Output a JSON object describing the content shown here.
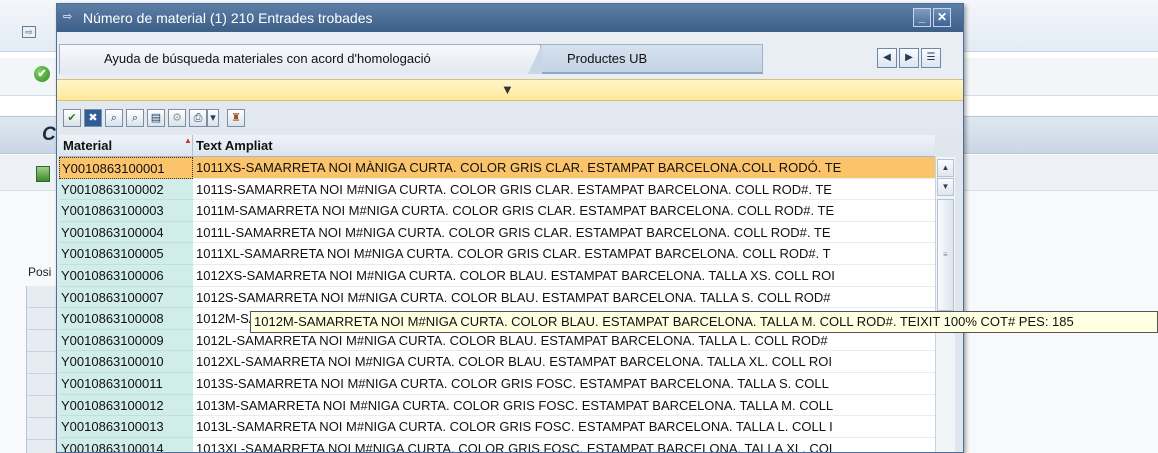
{
  "background": {
    "posi_label": "Posi",
    "title_initial": "C",
    "left_icon": "exit-icon",
    "check_icon": "check-circle-icon",
    "doc_icon": "document-icon"
  },
  "dialog": {
    "title": "Número de material (1)  210 Entrades trobades",
    "title_icon": "dialog-icon",
    "minimize_label": "_",
    "close_label": "✕",
    "tabs": [
      {
        "label": "Ayuda de búsqueda materiales con acord d'homologació",
        "active": false
      },
      {
        "label": "Productes UB",
        "active": true
      }
    ],
    "nav_buttons": [
      {
        "icon": "arrow-left-icon",
        "glyph": "◀"
      },
      {
        "icon": "arrow-right-icon",
        "glyph": "▶"
      },
      {
        "icon": "tab-list-icon",
        "glyph": "☰"
      }
    ],
    "filter_icon": "filter-icon",
    "toolbar": [
      {
        "icon": "checkmark-icon",
        "glyph": "✔"
      },
      {
        "icon": "cancel-icon",
        "glyph": "✖"
      },
      {
        "icon": "find-icon",
        "glyph": "⌕"
      },
      {
        "icon": "find-next-icon",
        "glyph": "⌕"
      },
      {
        "icon": "export-icon",
        "glyph": "▤"
      },
      {
        "icon": "settings-icon",
        "glyph": "⚙"
      },
      {
        "icon": "print-icon",
        "glyph": "⎙"
      },
      {
        "icon": "dropdown-icon",
        "glyph": "▾"
      },
      {
        "icon": "personal-list-icon",
        "glyph": "♜"
      }
    ]
  },
  "grid": {
    "columns": [
      "Material",
      "Text Ampliat"
    ],
    "rows": [
      {
        "material": "Y0010863100001",
        "text": "1011XS-SAMARRETA NOI MÀNIGA CURTA. COLOR GRIS CLAR. ESTAMPAT BARCELONA.COLL RODÓ. TE"
      },
      {
        "material": "Y0010863100002",
        "text": "1011S-SAMARRETA NOI M#NIGA CURTA. COLOR GRIS CLAR. ESTAMPAT BARCELONA. COLL ROD#. TE"
      },
      {
        "material": "Y0010863100003",
        "text": "1011M-SAMARRETA NOI M#NIGA CURTA. COLOR GRIS CLAR. ESTAMPAT BARCELONA. COLL ROD#. TE"
      },
      {
        "material": "Y0010863100004",
        "text": "1011L-SAMARRETA NOI M#NIGA CURTA. COLOR GRIS CLAR. ESTAMPAT BARCELONA. COLL ROD#. TE"
      },
      {
        "material": "Y0010863100005",
        "text": "1011XL-SAMARRETA NOI M#NIGA CURTA. COLOR GRIS CLAR. ESTAMPAT BARCELONA. COLL ROD#. T"
      },
      {
        "material": "Y0010863100006",
        "text": "1012XS-SAMARRETA NOI M#NIGA CURTA. COLOR BLAU. ESTAMPAT BARCELONA. TALLA XS. COLL ROI"
      },
      {
        "material": "Y0010863100007",
        "text": "1012S-SAMARRETA NOI M#NIGA CURTA. COLOR BLAU. ESTAMPAT BARCELONA. TALLA S. COLL ROD#"
      },
      {
        "material": "Y0010863100008",
        "text": "1012M-SAMARRETA NOI M#NIGA CURTA. COLOR BLAU. ESTAMPAT BARCELONA. TALLA M. COLL ROD#. TEIXIT 100% COT# PES: 185"
      },
      {
        "material": "Y0010863100009",
        "text": "1012L-SAMARRETA NOI M#NIGA CURTA. COLOR BLAU. ESTAMPAT BARCELONA. TALLA L. COLL ROD#"
      },
      {
        "material": "Y0010863100010",
        "text": "1012XL-SAMARRETA NOI M#NIGA CURTA. COLOR BLAU. ESTAMPAT BARCELONA. TALLA XL. COLL ROI"
      },
      {
        "material": "Y0010863100011",
        "text": "1013S-SAMARRETA NOI M#NIGA CURTA. COLOR GRIS FOSC. ESTAMPAT BARCELONA. TALLA S. COLL"
      },
      {
        "material": "Y0010863100012",
        "text": "1013M-SAMARRETA NOI M#NIGA CURTA. COLOR GRIS FOSC. ESTAMPAT BARCELONA. TALLA M. COLL"
      },
      {
        "material": "Y0010863100013",
        "text": "1013L-SAMARRETA NOI M#NIGA CURTA. COLOR GRIS FOSC. ESTAMPAT BARCELONA. TALLA L. COLL I"
      },
      {
        "material": "Y0010863100014",
        "text": "1013XL-SAMARRETA NOI M#NIGA CURTA. COLOR GRIS FOSC. ESTAMPAT BARCELONA. TALLA XL. COL"
      }
    ],
    "selected_row": 0
  },
  "tooltip": {
    "text": "1012M-SAMARRETA NOI M#NIGA CURTA. COLOR BLAU. ESTAMPAT BARCELONA. TALLA M. COLL ROD#. TEIXIT 100% COT# PES: 185"
  },
  "colors": {
    "title_bar": "#4a6d98",
    "selected_row": "#fcc46a",
    "material_column": "#d1edea",
    "filter_bar": "#ffe89a",
    "tooltip": "#ffffe1"
  }
}
